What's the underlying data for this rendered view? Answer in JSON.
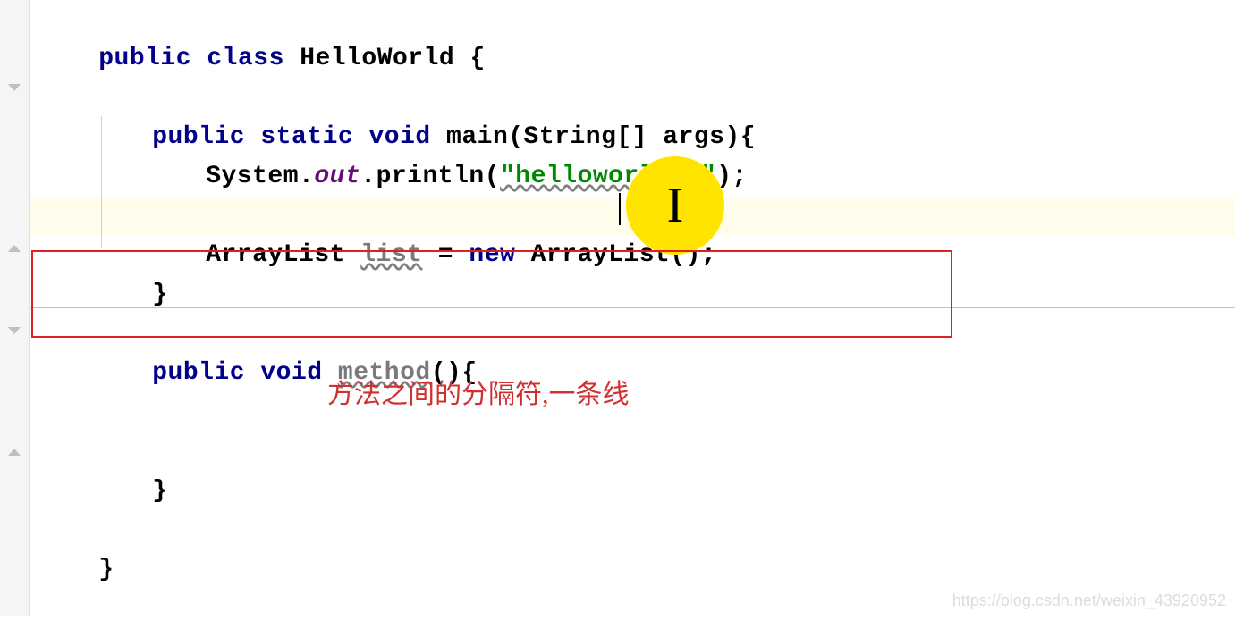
{
  "code": {
    "line1": {
      "kw_public": "public",
      "kw_class": "class",
      "classname": "HelloWorld",
      "brace": " {"
    },
    "line3": {
      "kw_public": "public",
      "kw_static": "static",
      "kw_void": "void",
      "method": "main",
      "params": "(String[] args){"
    },
    "line4": {
      "sys": "System.",
      "out": "out",
      "print": ".println(",
      "str": "\"helloworld!!\"",
      "end": ");"
    },
    "line6": {
      "arraylist": "ArrayList ",
      "varlist": "list",
      "eq": " = ",
      "kw_new": "new",
      "arraylist2": " ArrayList();"
    },
    "line7": {
      "brace": "}"
    },
    "line9": {
      "kw_public": "public",
      "kw_void": "void",
      "method": "method",
      "params": "(){"
    },
    "line12": {
      "brace": "}"
    },
    "line14": {
      "brace": "}"
    }
  },
  "annotation": "方法之间的分隔符,一条线",
  "watermark": "https://blog.csdn.net/weixin_43920952"
}
